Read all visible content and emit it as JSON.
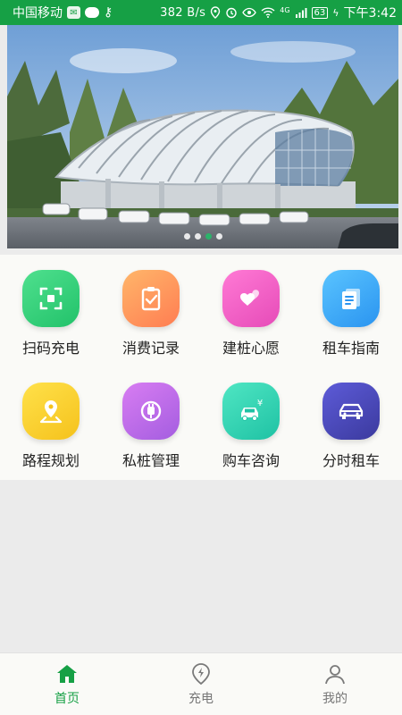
{
  "status_bar": {
    "carrier": "中国移动",
    "net_speed": "382 B/s",
    "net_type": "4G",
    "battery": "63",
    "time": "下午3:42",
    "icons": [
      "app-badge-icon",
      "chat-icon",
      "key-icon",
      "location-icon",
      "alarm-icon",
      "eye-icon",
      "wifi-icon",
      "signal-icon",
      "battery-icon",
      "charging-icon"
    ]
  },
  "banner": {
    "dots": 4,
    "active_dot": 2
  },
  "grid": {
    "items": [
      {
        "label": "扫码充电",
        "icon": "scan-icon",
        "color": "#2ecc71"
      },
      {
        "label": "消费记录",
        "icon": "clipboard-check-icon",
        "color": "#ff8a50"
      },
      {
        "label": "建桩心愿",
        "icon": "hearts-icon",
        "color": "#ee5ec6"
      },
      {
        "label": "租车指南",
        "icon": "document-icon",
        "color": "#3aa6f5"
      },
      {
        "label": "路程规划",
        "icon": "map-pin-icon",
        "color": "#f8cf22"
      },
      {
        "label": "私桩管理",
        "icon": "plug-icon",
        "color": "#b56ae6"
      },
      {
        "label": "购车咨询",
        "icon": "car-price-icon",
        "color": "#2ad2b2"
      },
      {
        "label": "分时租车",
        "icon": "car-icon",
        "color": "#4846b8"
      }
    ]
  },
  "bottom_nav": {
    "items": [
      {
        "label": "首页",
        "icon": "home-icon",
        "active": true
      },
      {
        "label": "充电",
        "icon": "charge-pin-icon",
        "active": false
      },
      {
        "label": "我的",
        "icon": "user-icon",
        "active": false
      }
    ],
    "active_color": "#16a045"
  }
}
